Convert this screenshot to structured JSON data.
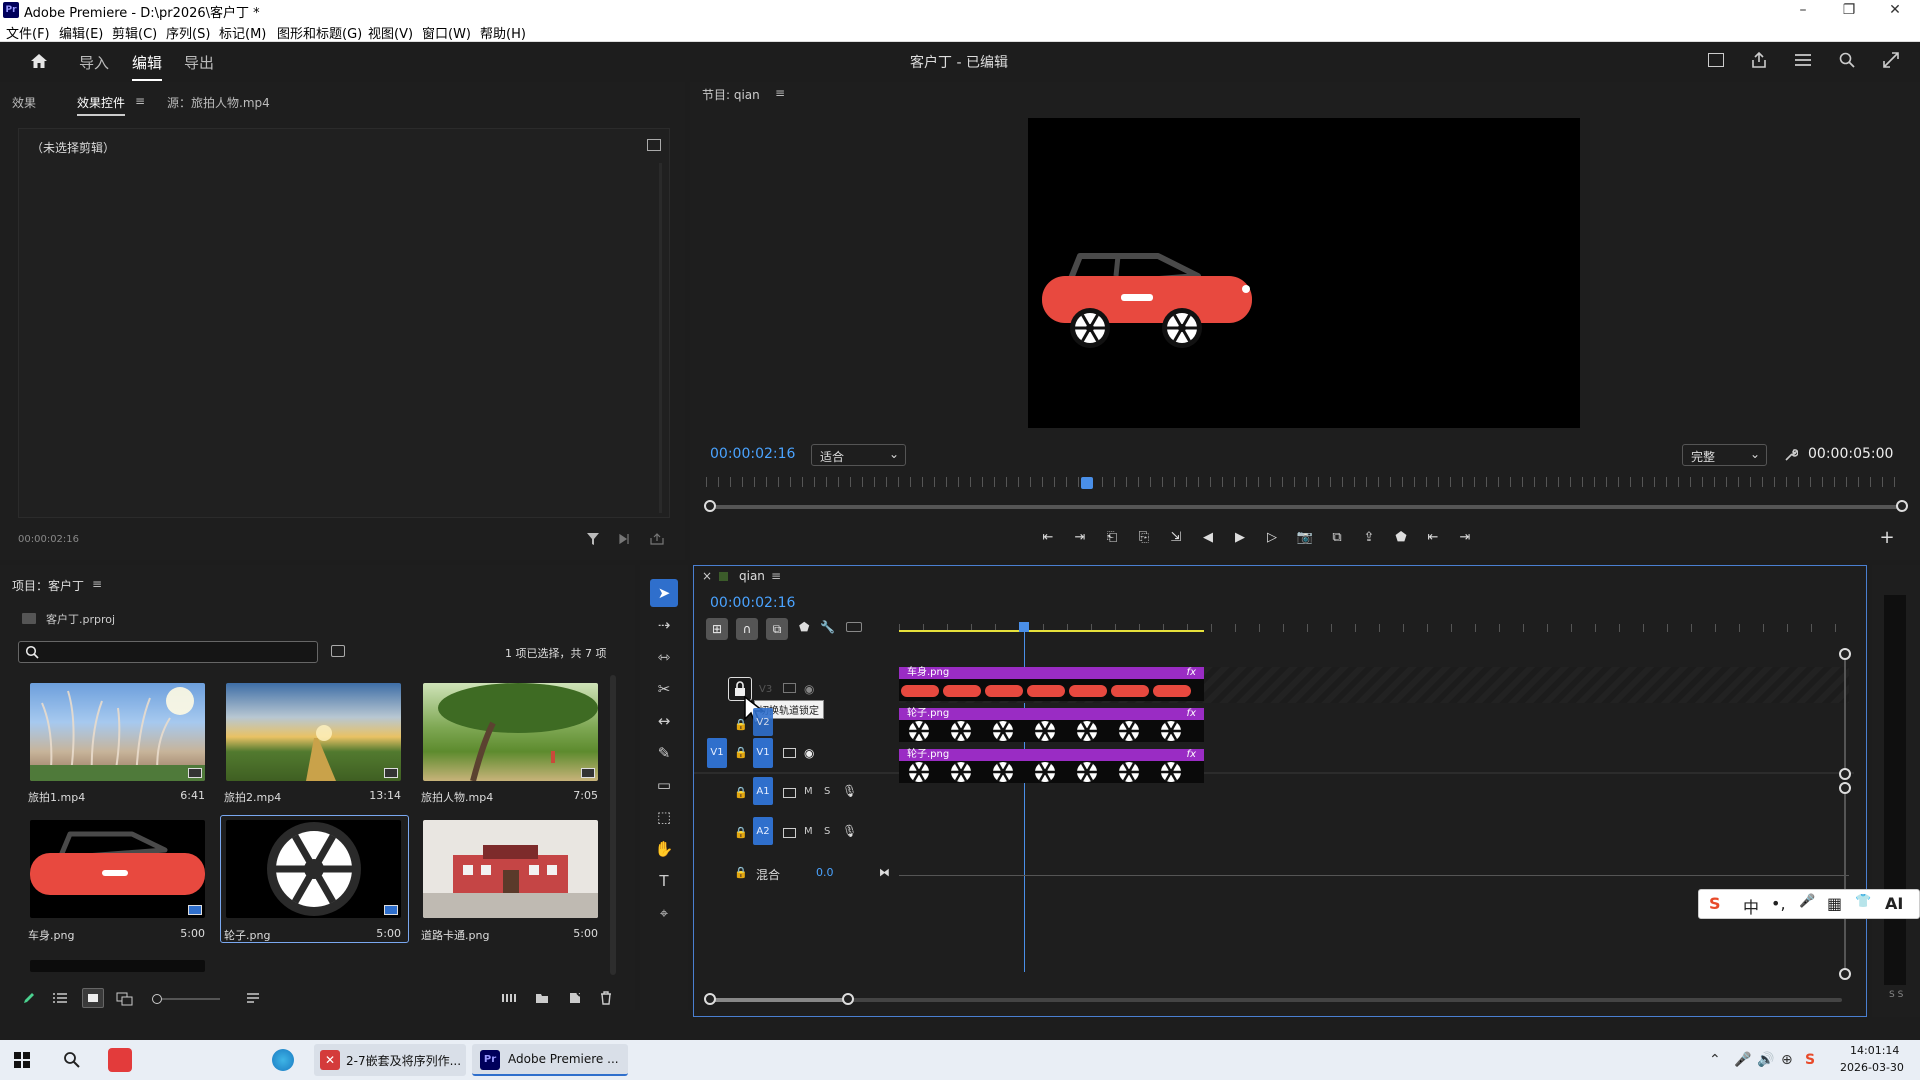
{
  "window": {
    "app_badge": "Pr",
    "title": "Adobe Premiere - D:\\pr2026\\客户丁 *",
    "controls": {
      "minimize": "–",
      "maximize": "❐",
      "close": "✕"
    }
  },
  "menu": {
    "items": [
      "文件(F)",
      "编辑(E)",
      "剪辑(C)",
      "序列(S)",
      "标记(M)",
      "图形和标题(G)",
      "视图(V)",
      "窗口(W)",
      "帮助(H)"
    ]
  },
  "workspace": {
    "tabs": [
      "导入",
      "编辑",
      "导出"
    ],
    "active_tab": "编辑",
    "project_status": "客户丁 - 已编辑"
  },
  "effect_controls": {
    "tabs": [
      "效果",
      "效果控件",
      "源：旅拍人物.mp4"
    ],
    "active_tab": "效果控件",
    "menu_icon": "≡",
    "no_clip_text": "（未选择剪辑）",
    "timecode": "00:00:02:16"
  },
  "program_monitor": {
    "title": "节目: qian",
    "menu_icon": "≡",
    "timecode": "00:00:02:16",
    "zoom_select": "适合",
    "quality_select": "完整",
    "duration": "00:00:05:00",
    "playhead_fraction": 0.32
  },
  "project_panel": {
    "title": "项目：客户丁",
    "menu_icon": "≡",
    "file_name": "客户丁.prproj",
    "search_placeholder": "",
    "selection_info": "1 项已选择，共 7 项",
    "items": [
      {
        "name": "旅拍1.mp4",
        "duration": "6:41"
      },
      {
        "name": "旅拍2.mp4",
        "duration": "13:14"
      },
      {
        "name": "旅拍人物.mp4",
        "duration": "7:05"
      },
      {
        "name": "车身.png",
        "duration": "5:00"
      },
      {
        "name": "轮子.png",
        "duration": "5:00"
      },
      {
        "name": "道路卡通.png",
        "duration": "5:00"
      }
    ]
  },
  "timeline": {
    "close_icon": "×",
    "sequence_name": "qian",
    "menu_icon": "≡",
    "timecode": "00:00:02:16",
    "tooltip": "切换轨道锁定",
    "tracks": {
      "video": [
        {
          "label": "V3",
          "clip": "车身.png"
        },
        {
          "label": "V2",
          "clip": "轮子.png"
        },
        {
          "label": "V1",
          "clip": "轮子.png",
          "source_patch": "V1"
        }
      ],
      "audio": [
        {
          "label": "A1",
          "m": "M",
          "s": "S"
        },
        {
          "label": "A2",
          "m": "M",
          "s": "S"
        }
      ],
      "mix": {
        "label": "混合",
        "value": "0.0"
      }
    },
    "fx_badge": "fx",
    "playhead_fraction": 0.32
  },
  "audio_meter": {
    "labels": "S S"
  },
  "ime": {
    "items": [
      "S",
      "中",
      "•,",
      "🎤",
      "▦",
      "👕",
      "AI"
    ]
  },
  "taskbar": {
    "apps": [
      {
        "label": "2-7嵌套及将序列作..."
      },
      {
        "label": "Adobe Premiere ..."
      }
    ],
    "time": "14:01:14",
    "date": "2026-03-30"
  },
  "colors": {
    "accent_blue": "#2f6fcc",
    "timecode_blue": "#4aa3ff",
    "clip_purple": "#9a2cc4",
    "car_red": "#e8493f"
  }
}
